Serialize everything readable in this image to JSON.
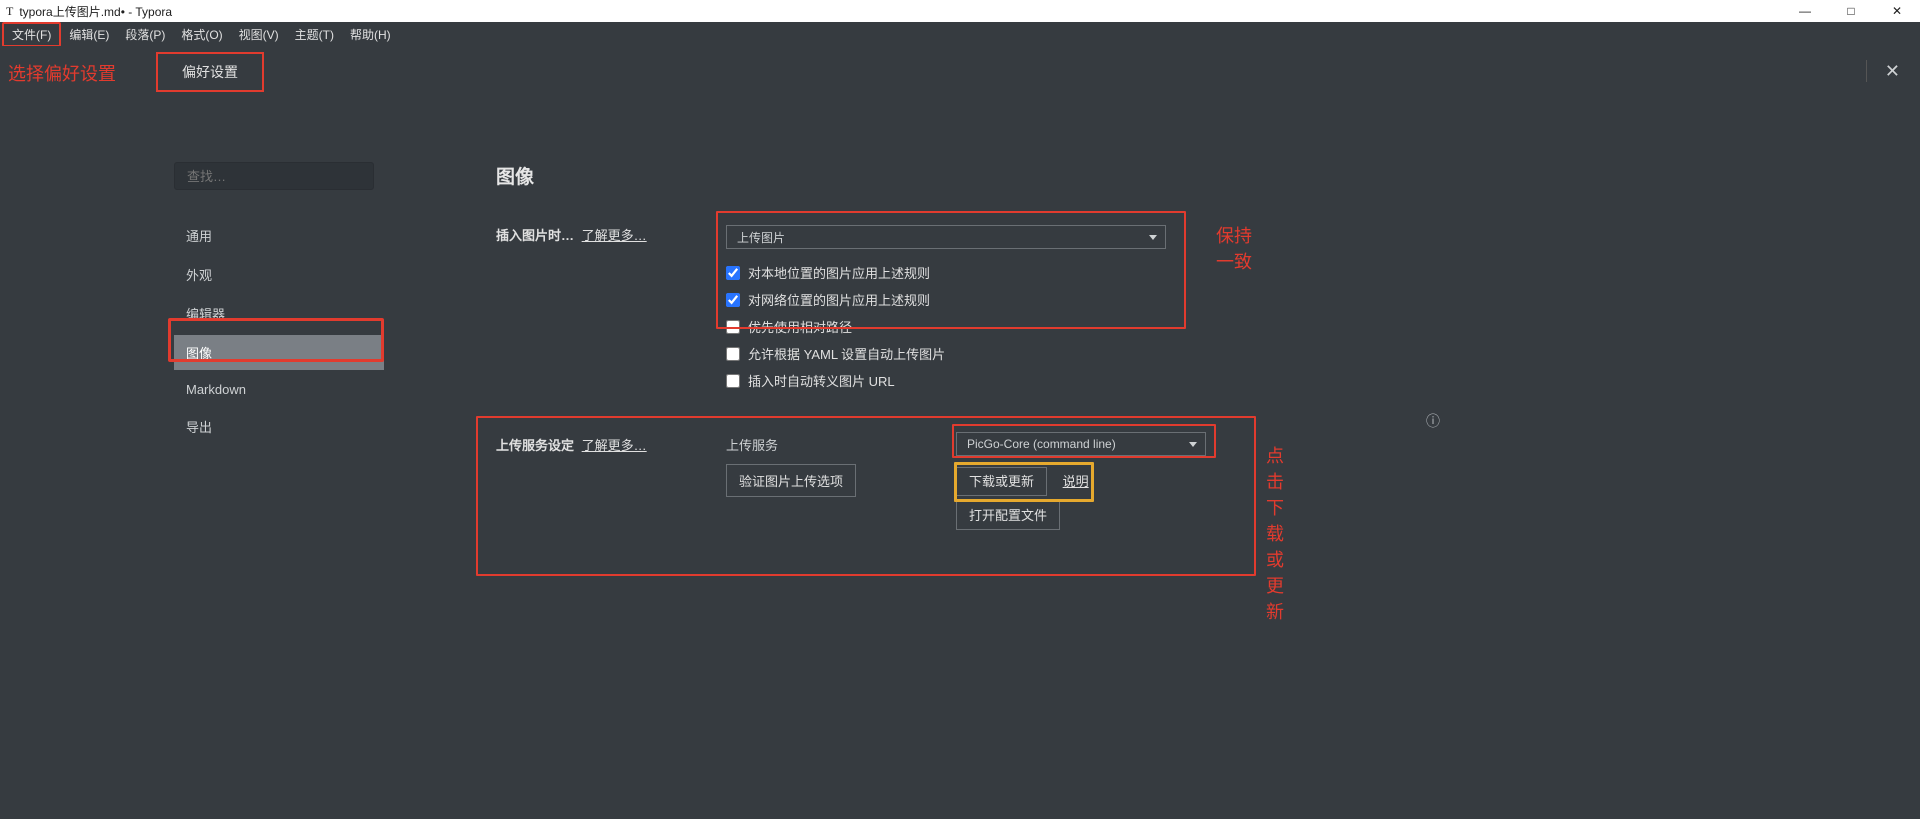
{
  "window": {
    "title": "typora上传图片.md• - Typora",
    "controls": {
      "min": "—",
      "max": "□",
      "close": "✕"
    }
  },
  "menubar": {
    "items": [
      "文件(F)",
      "编辑(E)",
      "段落(P)",
      "格式(O)",
      "视图(V)",
      "主题(T)",
      "帮助(H)"
    ]
  },
  "annotations": {
    "choose_pref": "选择偏好设置",
    "pref_tab": "偏好设置",
    "keep_consistent": "保持一致",
    "click_download": "点击下载或更新"
  },
  "sidebar": {
    "search_placeholder": "查找…",
    "items": [
      "通用",
      "外观",
      "编辑器",
      "图像",
      "Markdown",
      "导出"
    ],
    "active_index": 3
  },
  "main": {
    "heading": "图像",
    "insert_label": "插入图片时…",
    "learn_more": "了解更多…",
    "insert_dropdown": "上传图片",
    "checks": [
      {
        "label": "对本地位置的图片应用上述规则",
        "checked": true
      },
      {
        "label": "对网络位置的图片应用上述规则",
        "checked": true
      },
      {
        "label": "优先使用相对路径",
        "checked": false
      },
      {
        "label": "允许根据 YAML 设置自动上传图片",
        "checked": false
      },
      {
        "label": "插入时自动转义图片 URL",
        "checked": false
      }
    ],
    "upload_section_label": "上传服务设定",
    "upload_service_label": "上传服务",
    "upload_service_value": "PicGo-Core (command line)",
    "validate_btn": "验证图片上传选项",
    "download_btn": "下载或更新",
    "help_link": "说明",
    "open_config_btn": "打开配置文件"
  }
}
